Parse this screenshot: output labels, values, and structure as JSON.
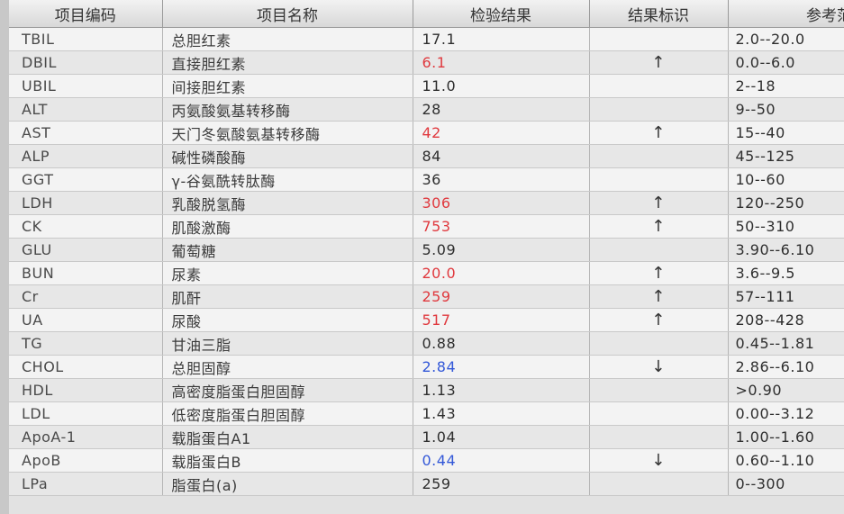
{
  "table": {
    "headers": {
      "code": "项目编码",
      "name": "项目名称",
      "result": "检验结果",
      "flag": "结果标识",
      "ref": "参考范围"
    },
    "rows": [
      {
        "code": "TBIL",
        "name": "总胆红素",
        "result": "17.1",
        "status": "normal",
        "flag": "",
        "ref": "2.0--20.0"
      },
      {
        "code": "DBIL",
        "name": "直接胆红素",
        "result": "6.1",
        "status": "high",
        "flag": "↑",
        "ref": "0.0--6.0"
      },
      {
        "code": "UBIL",
        "name": "间接胆红素",
        "result": "11.0",
        "status": "normal",
        "flag": "",
        "ref": "2--18"
      },
      {
        "code": "ALT",
        "name": "丙氨酸氨基转移酶",
        "result": "28",
        "status": "normal",
        "flag": "",
        "ref": "9--50"
      },
      {
        "code": "AST",
        "name": "天门冬氨酸氨基转移酶",
        "result": "42",
        "status": "high",
        "flag": "↑",
        "ref": "15--40"
      },
      {
        "code": "ALP",
        "name": "碱性磷酸酶",
        "result": "84",
        "status": "normal",
        "flag": "",
        "ref": "45--125"
      },
      {
        "code": "GGT",
        "name": "γ-谷氨酰转肽酶",
        "result": "36",
        "status": "normal",
        "flag": "",
        "ref": "10--60"
      },
      {
        "code": "LDH",
        "name": "乳酸脱氢酶",
        "result": "306",
        "status": "high",
        "flag": "↑",
        "ref": "120--250"
      },
      {
        "code": "CK",
        "name": "肌酸激酶",
        "result": "753",
        "status": "high",
        "flag": "↑",
        "ref": "50--310"
      },
      {
        "code": "GLU",
        "name": "葡萄糖",
        "result": "5.09",
        "status": "normal",
        "flag": "",
        "ref": "3.90--6.10"
      },
      {
        "code": "BUN",
        "name": "尿素",
        "result": "20.0",
        "status": "high",
        "flag": "↑",
        "ref": "3.6--9.5"
      },
      {
        "code": "Cr",
        "name": "肌酐",
        "result": "259",
        "status": "high",
        "flag": "↑",
        "ref": "57--111"
      },
      {
        "code": "UA",
        "name": "尿酸",
        "result": "517",
        "status": "high",
        "flag": "↑",
        "ref": "208--428"
      },
      {
        "code": "TG",
        "name": "甘油三脂",
        "result": "0.88",
        "status": "normal",
        "flag": "",
        "ref": "0.45--1.81"
      },
      {
        "code": "CHOL",
        "name": "总胆固醇",
        "result": "2.84",
        "status": "low",
        "flag": "↓",
        "ref": "2.86--6.10"
      },
      {
        "code": "HDL",
        "name": "高密度脂蛋白胆固醇",
        "result": "1.13",
        "status": "normal",
        "flag": "",
        "ref": ">0.90"
      },
      {
        "code": "LDL",
        "name": "低密度脂蛋白胆固醇",
        "result": "1.43",
        "status": "normal",
        "flag": "",
        "ref": "0.00--3.12"
      },
      {
        "code": "ApoA-1",
        "name": "载脂蛋白A1",
        "result": "1.04",
        "status": "normal",
        "flag": "",
        "ref": "1.00--1.60"
      },
      {
        "code": "ApoB",
        "name": "载脂蛋白B",
        "result": "0.44",
        "status": "low",
        "flag": "↓",
        "ref": "0.60--1.10"
      },
      {
        "code": "LPa",
        "name": "脂蛋白(a)",
        "result": "259",
        "status": "normal",
        "flag": "",
        "ref": "0--300"
      }
    ]
  },
  "colors": {
    "high": "#e0393e",
    "low": "#3358d8",
    "normal": "#2e2e2e"
  }
}
